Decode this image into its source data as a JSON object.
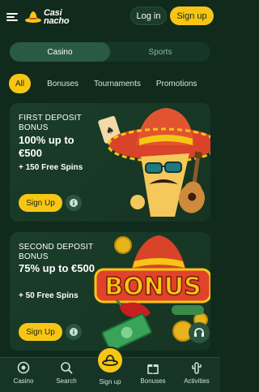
{
  "header": {
    "logo_line1": "Casi",
    "logo_line2": "nacho",
    "login": "Log in",
    "signup": "Sign up"
  },
  "segment": {
    "tabs": [
      "Casino",
      "Sports"
    ],
    "active": "Casino"
  },
  "chips": [
    "All",
    "Bonuses",
    "Tournaments",
    "Promotions"
  ],
  "cards": [
    {
      "title": "FIRST DEPOSIT BONUS",
      "main": "100% up to €500",
      "sub": "+ 150 Free Spins",
      "cta": "Sign Up"
    },
    {
      "title": "SECOND DEPOSIT BONUS",
      "main": "75% up to €500",
      "sub": "+ 50 Free Spins",
      "cta": "Sign Up",
      "art_text": "BONUS"
    }
  ],
  "bottom_nav": {
    "items": [
      "Casino",
      "Search",
      "Sign up",
      "Bonuses",
      "Activities"
    ]
  },
  "colors": {
    "accent": "#f7c614",
    "bg": "#102a1c",
    "card": "#1a3d2a"
  }
}
